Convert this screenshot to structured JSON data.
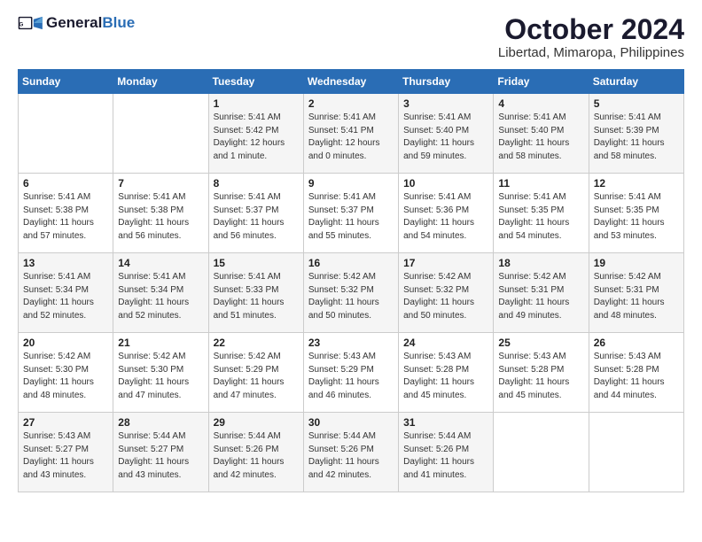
{
  "logo": {
    "general": "General",
    "blue": "Blue"
  },
  "title": "October 2024",
  "location": "Libertad, Mimaropa, Philippines",
  "days_header": [
    "Sunday",
    "Monday",
    "Tuesday",
    "Wednesday",
    "Thursday",
    "Friday",
    "Saturday"
  ],
  "weeks": [
    [
      {
        "day": "",
        "info": ""
      },
      {
        "day": "",
        "info": ""
      },
      {
        "day": "1",
        "info": "Sunrise: 5:41 AM\nSunset: 5:42 PM\nDaylight: 12 hours\nand 1 minute."
      },
      {
        "day": "2",
        "info": "Sunrise: 5:41 AM\nSunset: 5:41 PM\nDaylight: 12 hours\nand 0 minutes."
      },
      {
        "day": "3",
        "info": "Sunrise: 5:41 AM\nSunset: 5:40 PM\nDaylight: 11 hours\nand 59 minutes."
      },
      {
        "day": "4",
        "info": "Sunrise: 5:41 AM\nSunset: 5:40 PM\nDaylight: 11 hours\nand 58 minutes."
      },
      {
        "day": "5",
        "info": "Sunrise: 5:41 AM\nSunset: 5:39 PM\nDaylight: 11 hours\nand 58 minutes."
      }
    ],
    [
      {
        "day": "6",
        "info": "Sunrise: 5:41 AM\nSunset: 5:38 PM\nDaylight: 11 hours\nand 57 minutes."
      },
      {
        "day": "7",
        "info": "Sunrise: 5:41 AM\nSunset: 5:38 PM\nDaylight: 11 hours\nand 56 minutes."
      },
      {
        "day": "8",
        "info": "Sunrise: 5:41 AM\nSunset: 5:37 PM\nDaylight: 11 hours\nand 56 minutes."
      },
      {
        "day": "9",
        "info": "Sunrise: 5:41 AM\nSunset: 5:37 PM\nDaylight: 11 hours\nand 55 minutes."
      },
      {
        "day": "10",
        "info": "Sunrise: 5:41 AM\nSunset: 5:36 PM\nDaylight: 11 hours\nand 54 minutes."
      },
      {
        "day": "11",
        "info": "Sunrise: 5:41 AM\nSunset: 5:35 PM\nDaylight: 11 hours\nand 54 minutes."
      },
      {
        "day": "12",
        "info": "Sunrise: 5:41 AM\nSunset: 5:35 PM\nDaylight: 11 hours\nand 53 minutes."
      }
    ],
    [
      {
        "day": "13",
        "info": "Sunrise: 5:41 AM\nSunset: 5:34 PM\nDaylight: 11 hours\nand 52 minutes."
      },
      {
        "day": "14",
        "info": "Sunrise: 5:41 AM\nSunset: 5:34 PM\nDaylight: 11 hours\nand 52 minutes."
      },
      {
        "day": "15",
        "info": "Sunrise: 5:41 AM\nSunset: 5:33 PM\nDaylight: 11 hours\nand 51 minutes."
      },
      {
        "day": "16",
        "info": "Sunrise: 5:42 AM\nSunset: 5:32 PM\nDaylight: 11 hours\nand 50 minutes."
      },
      {
        "day": "17",
        "info": "Sunrise: 5:42 AM\nSunset: 5:32 PM\nDaylight: 11 hours\nand 50 minutes."
      },
      {
        "day": "18",
        "info": "Sunrise: 5:42 AM\nSunset: 5:31 PM\nDaylight: 11 hours\nand 49 minutes."
      },
      {
        "day": "19",
        "info": "Sunrise: 5:42 AM\nSunset: 5:31 PM\nDaylight: 11 hours\nand 48 minutes."
      }
    ],
    [
      {
        "day": "20",
        "info": "Sunrise: 5:42 AM\nSunset: 5:30 PM\nDaylight: 11 hours\nand 48 minutes."
      },
      {
        "day": "21",
        "info": "Sunrise: 5:42 AM\nSunset: 5:30 PM\nDaylight: 11 hours\nand 47 minutes."
      },
      {
        "day": "22",
        "info": "Sunrise: 5:42 AM\nSunset: 5:29 PM\nDaylight: 11 hours\nand 47 minutes."
      },
      {
        "day": "23",
        "info": "Sunrise: 5:43 AM\nSunset: 5:29 PM\nDaylight: 11 hours\nand 46 minutes."
      },
      {
        "day": "24",
        "info": "Sunrise: 5:43 AM\nSunset: 5:28 PM\nDaylight: 11 hours\nand 45 minutes."
      },
      {
        "day": "25",
        "info": "Sunrise: 5:43 AM\nSunset: 5:28 PM\nDaylight: 11 hours\nand 45 minutes."
      },
      {
        "day": "26",
        "info": "Sunrise: 5:43 AM\nSunset: 5:28 PM\nDaylight: 11 hours\nand 44 minutes."
      }
    ],
    [
      {
        "day": "27",
        "info": "Sunrise: 5:43 AM\nSunset: 5:27 PM\nDaylight: 11 hours\nand 43 minutes."
      },
      {
        "day": "28",
        "info": "Sunrise: 5:44 AM\nSunset: 5:27 PM\nDaylight: 11 hours\nand 43 minutes."
      },
      {
        "day": "29",
        "info": "Sunrise: 5:44 AM\nSunset: 5:26 PM\nDaylight: 11 hours\nand 42 minutes."
      },
      {
        "day": "30",
        "info": "Sunrise: 5:44 AM\nSunset: 5:26 PM\nDaylight: 11 hours\nand 42 minutes."
      },
      {
        "day": "31",
        "info": "Sunrise: 5:44 AM\nSunset: 5:26 PM\nDaylight: 11 hours\nand 41 minutes."
      },
      {
        "day": "",
        "info": ""
      },
      {
        "day": "",
        "info": ""
      }
    ]
  ]
}
